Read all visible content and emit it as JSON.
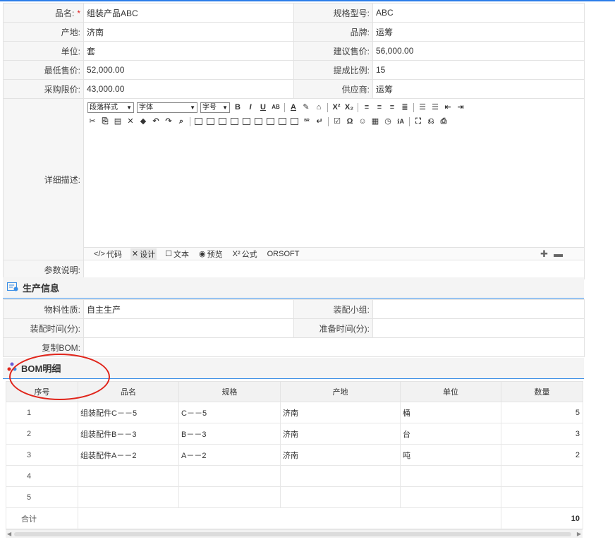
{
  "basic": {
    "product_name_label": "品名:",
    "product_name": "组装产品ABC",
    "spec_label": "规格型号:",
    "spec": "ABC",
    "origin_label": "产地:",
    "origin": "济南",
    "brand_label": "品牌:",
    "brand": "运筹",
    "unit_label": "单位:",
    "unit": "套",
    "suggested_price_label": "建议售价:",
    "suggested_price": "56,000.00",
    "min_price_label": "最低售价:",
    "min_price": "52,000.00",
    "commission_label": "提成比例:",
    "commission": "15",
    "purchase_limit_label": "采购限价:",
    "purchase_limit": "43,000.00",
    "supplier_label": "供应商:",
    "supplier": "运筹",
    "detail_label": "详细描述:",
    "param_label": "参数说明:"
  },
  "editor": {
    "paragraph_select": "段落样式",
    "font_select": "字体",
    "size_select": "字号",
    "modes": {
      "code": "代码",
      "design": "设计",
      "text": "文本",
      "preview": "预览",
      "formula": "公式",
      "brand": "ORSOFT"
    }
  },
  "production": {
    "section_title": "生产信息",
    "material_label": "物料性质:",
    "material": "自主生产",
    "assembly_group_label": "装配小组:",
    "assembly_time_label": "装配时间(分):",
    "prep_time_label": "准备时间(分):",
    "copy_bom_label": "复制BOM:"
  },
  "bom": {
    "section_title": "BOM明细",
    "columns": [
      "序号",
      "品名",
      "规格",
      "产地",
      "单位",
      "数量"
    ],
    "rows": [
      {
        "idx": "1",
        "name": "组装配件C－－5",
        "spec": "C－－5",
        "origin": "济南",
        "unit": "桶",
        "qty": "5"
      },
      {
        "idx": "2",
        "name": "组装配件B－－3",
        "spec": "B－－3",
        "origin": "济南",
        "unit": "台",
        "qty": "3"
      },
      {
        "idx": "3",
        "name": "组装配件A－－2",
        "spec": "A－－2",
        "origin": "济南",
        "unit": "吨",
        "qty": "2"
      },
      {
        "idx": "4",
        "name": "",
        "spec": "",
        "origin": "",
        "unit": "",
        "qty": ""
      },
      {
        "idx": "5",
        "name": "",
        "spec": "",
        "origin": "",
        "unit": "",
        "qty": ""
      }
    ],
    "total_label": "合计",
    "total_qty": "10"
  },
  "colors": {
    "accent": "#3a8ee6",
    "annotation_circle": "#e0251b",
    "required": "#e02020"
  }
}
